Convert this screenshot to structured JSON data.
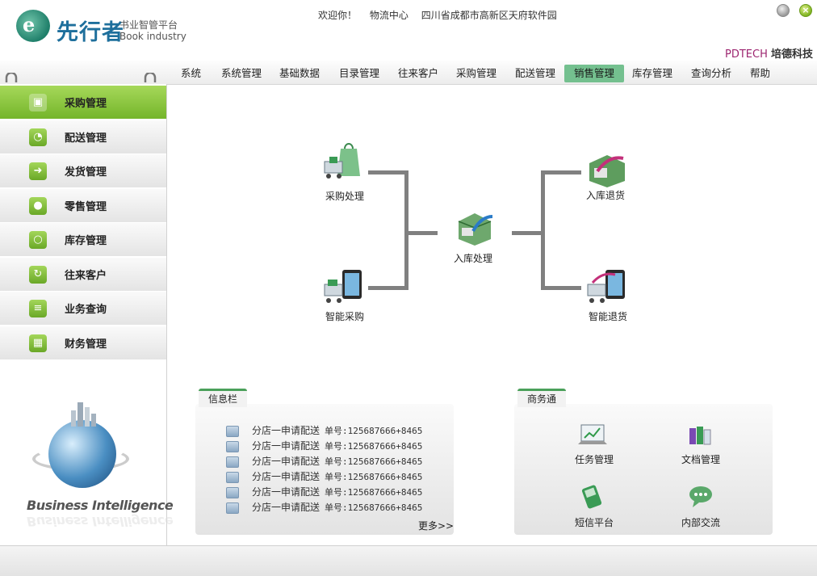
{
  "header": {
    "logo_letter": "e",
    "brand": "先行者",
    "brand_cn": "书业智管平台",
    "brand_en": "Book industry",
    "welcome": "欢迎你！",
    "center": "物流中心",
    "address": "四川省成都市高新区天府软件园",
    "company_en": "PDTECH",
    "company_cn": "培德科技"
  },
  "nav": {
    "items": [
      "系统",
      "系统管理",
      "基础数据",
      "目录管理",
      "往来客户",
      "采购管理",
      "配送管理",
      "销售管理",
      "库存管理",
      "查询分析",
      "帮助"
    ],
    "active": "销售管理"
  },
  "sidebar": {
    "items": [
      {
        "label": "采购管理",
        "icon": "cart-icon"
      },
      {
        "label": "配送管理",
        "icon": "rss-icon"
      },
      {
        "label": "发货管理",
        "icon": "arrow-right-icon"
      },
      {
        "label": "零售管理",
        "icon": "user-icon"
      },
      {
        "label": "库存管理",
        "icon": "ring-icon"
      },
      {
        "label": "往来客户",
        "icon": "refresh-icon"
      },
      {
        "label": "业务查询",
        "icon": "list-icon"
      },
      {
        "label": "财务管理",
        "icon": "calendar-icon"
      }
    ],
    "active": "采购管理",
    "bi_text": "Business Intelligence"
  },
  "flow": {
    "purchase_process": "采购处理",
    "smart_purchase": "智能采购",
    "inbound_process": "入库处理",
    "inbound_return": "入库退货",
    "smart_return": "智能退货"
  },
  "info_panel": {
    "tab": "信息栏",
    "messages": [
      {
        "text": "分店一申请配送",
        "order": "单号:125687666+8465"
      },
      {
        "text": "分店一申请配送",
        "order": "单号:125687666+8465"
      },
      {
        "text": "分店一申请配送",
        "order": "单号:125687666+8465"
      },
      {
        "text": "分店一申请配送",
        "order": "单号:125687666+8465"
      },
      {
        "text": "分店一申请配送",
        "order": "单号:125687666+8465"
      },
      {
        "text": "分店一申请配送",
        "order": "单号:125687666+8465"
      }
    ],
    "more": "更多>>"
  },
  "biz_panel": {
    "tab": "商务通",
    "items": [
      "任务管理",
      "文档管理",
      "短信平台",
      "内部交流"
    ]
  },
  "colors": {
    "nav_active": "#74c08f",
    "sidebar_active": "#8dc63f",
    "company_accent": "#9d2670",
    "flow_line": "#808080"
  }
}
